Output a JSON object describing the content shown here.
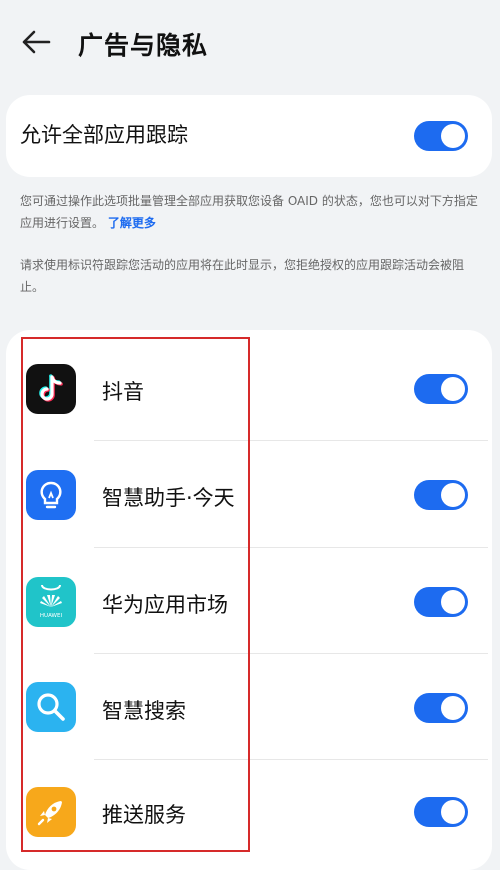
{
  "header": {
    "title": "广告与隐私"
  },
  "allow_all": {
    "label": "允许全部应用跟踪",
    "on": true
  },
  "description": {
    "text1": "您可通过操作此选项批量管理全部应用获取您设备 OAID 的状态，您也可以对下方指定应用进行设置。",
    "learn_more": "了解更多",
    "text2": "请求使用标识符跟踪您活动的应用将在此时显示，您拒绝授权的应用跟踪活动会被阻止。"
  },
  "apps": [
    {
      "name": "抖音",
      "icon": "tiktok-icon",
      "on": true
    },
    {
      "name": "智慧助手·今天",
      "icon": "lightbulb-icon",
      "on": true
    },
    {
      "name": "华为应用市场",
      "icon": "huawei-appgallery-icon",
      "on": true,
      "icon_text": "HUAWEI"
    },
    {
      "name": "智慧搜索",
      "icon": "search-icon",
      "on": true
    },
    {
      "name": "推送服务",
      "icon": "rocket-icon",
      "on": true
    }
  ],
  "colors": {
    "accent": "#1d6bf0",
    "highlight": "#d62a2a",
    "background": "#f1f3f5"
  }
}
